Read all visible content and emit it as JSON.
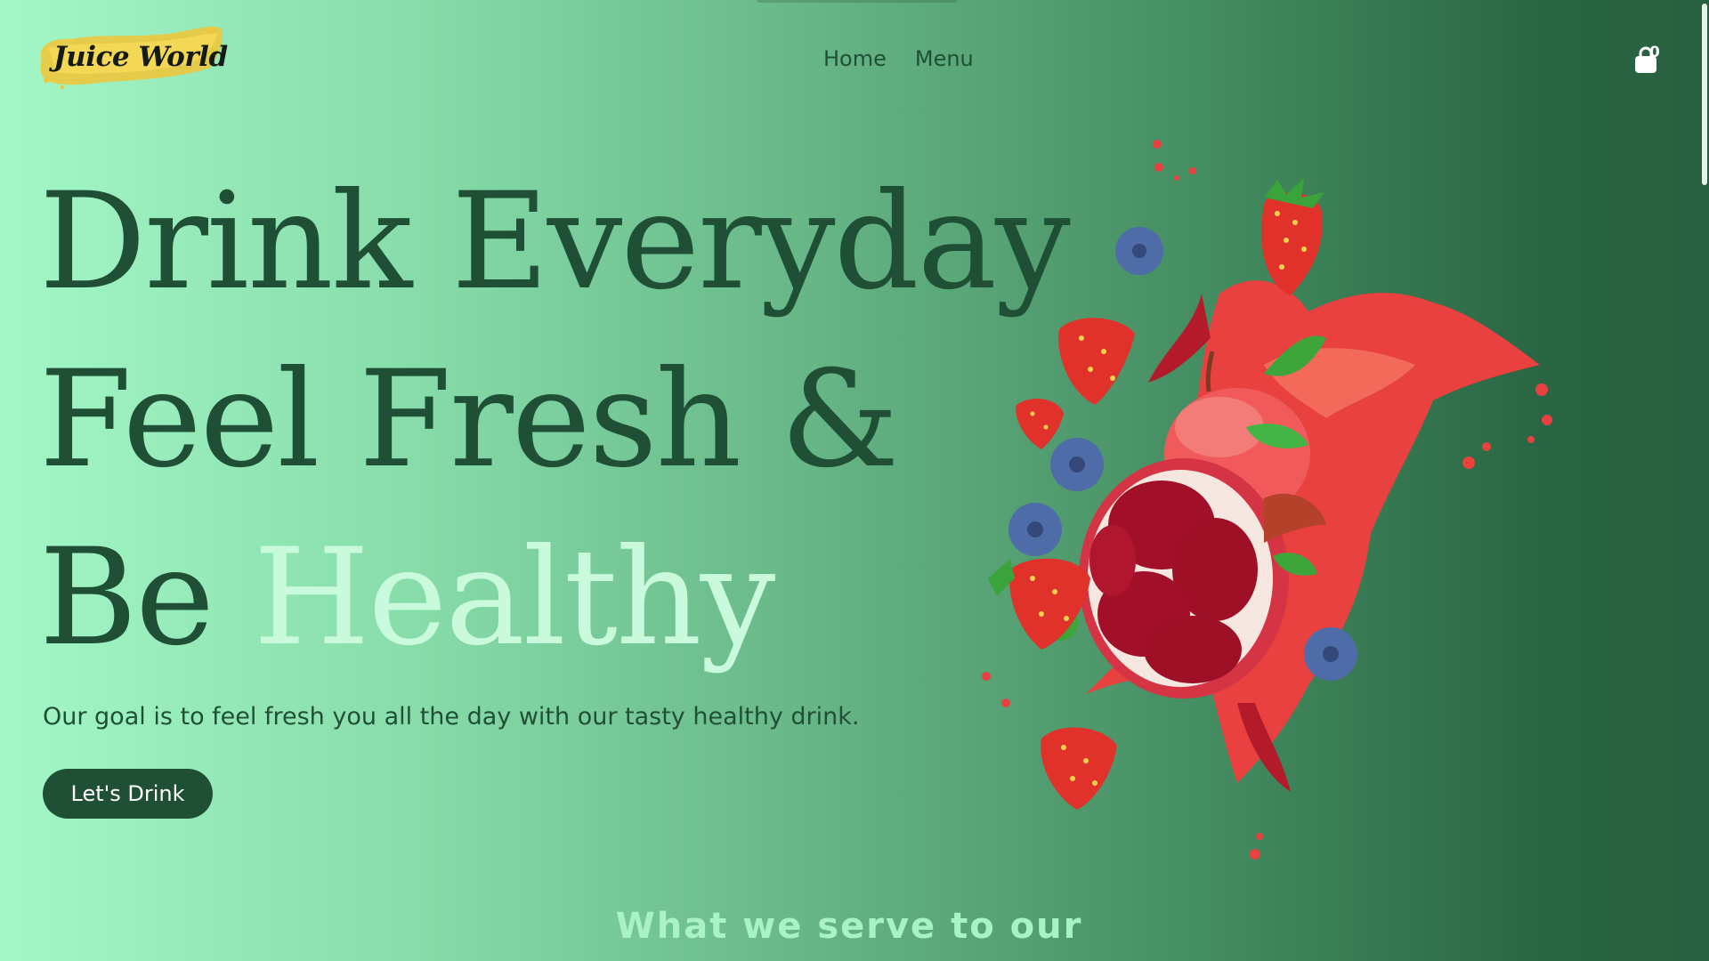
{
  "brand": {
    "logo_text": "Juice World"
  },
  "nav": {
    "items": [
      {
        "label": "Home"
      },
      {
        "label": "Menu"
      }
    ]
  },
  "cart": {
    "count": "0"
  },
  "hero": {
    "line1": "Drink Everyday",
    "line2": "Feel Fresh &",
    "line3_prefix": "Be",
    "line3_accent": "Healthy",
    "subtitle": "Our goal is to feel fresh you all the day with our tasty healthy drink.",
    "cta_label": "Let's Drink"
  },
  "section": {
    "heading": "What we serve to our"
  },
  "colors": {
    "primary": "#1f5036",
    "accent_text": "#c8fadb",
    "background_left": "#a4f7c7",
    "background_right": "#27603f"
  }
}
